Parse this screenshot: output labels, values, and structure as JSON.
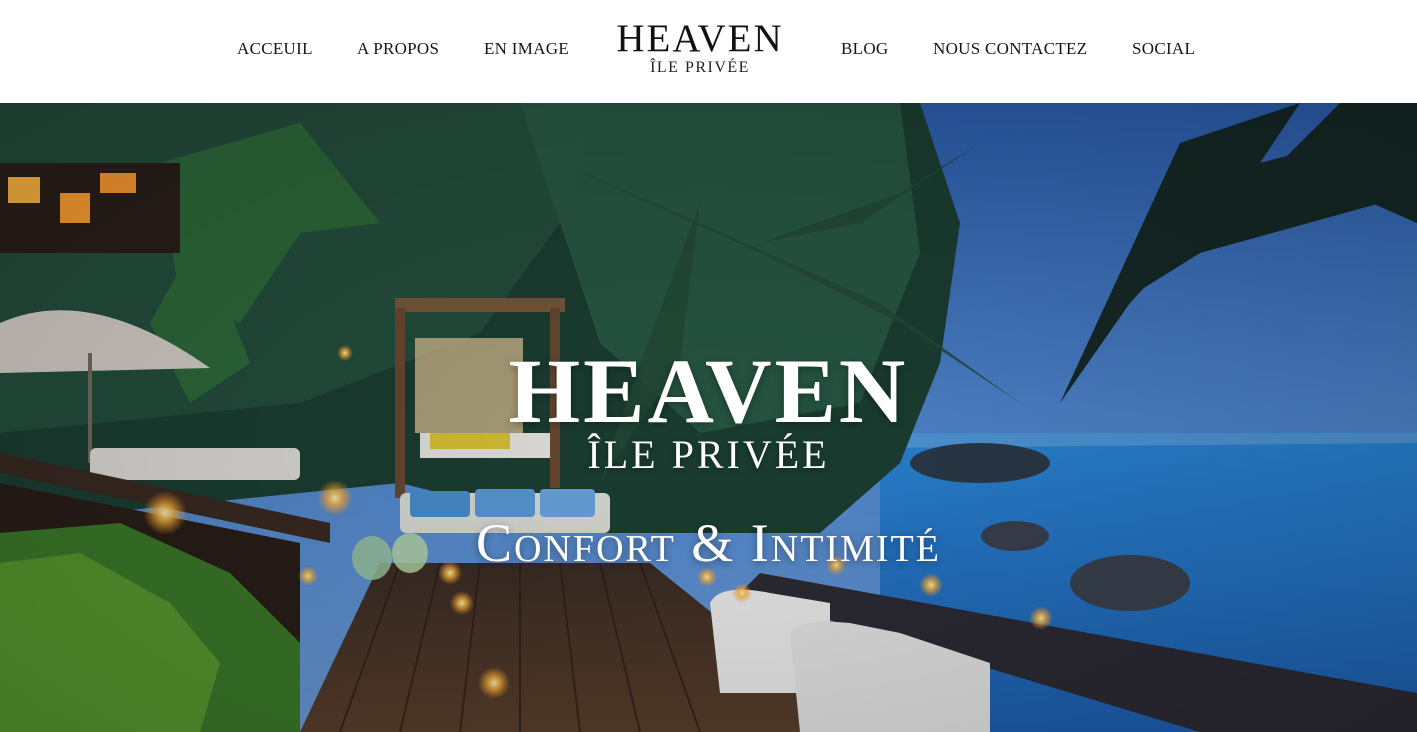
{
  "nav": {
    "left": [
      {
        "label": "ACCEUIL"
      },
      {
        "label": "A PROPOS"
      },
      {
        "label": "EN IMAGE"
      }
    ],
    "right": [
      {
        "label": "BLOG"
      },
      {
        "label": "NOUS CONTACTEZ"
      },
      {
        "label": "SOCIAL"
      }
    ]
  },
  "logo": {
    "title": "HEAVEN",
    "subtitle": "ÎLE PRIVÉE"
  },
  "hero": {
    "title": "HEAVEN",
    "subtitle": "ÎLE PRIVÉE",
    "tagline": "Confort & Intimité",
    "image": "tropical-resort-deck-at-dusk",
    "colors": {
      "sky": "#3b78c8",
      "sea": "#2f8fe0",
      "foliage": "#1f4a2c",
      "candle": "#ffc24a",
      "deck": "#4a3426"
    }
  }
}
